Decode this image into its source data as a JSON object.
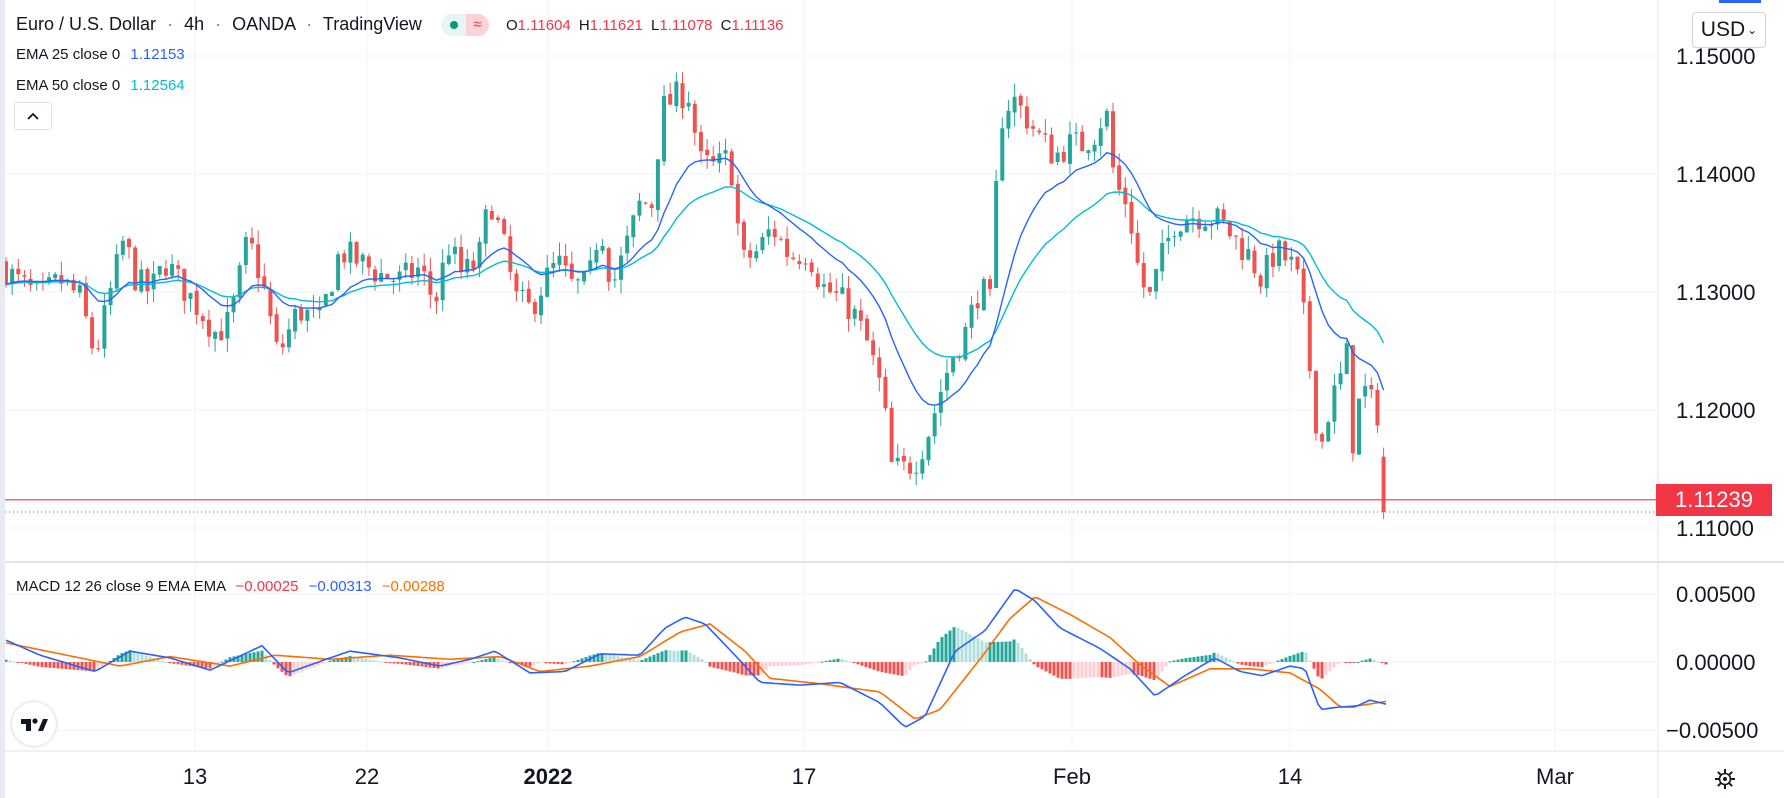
{
  "header": {
    "symbol": "Euro / U.S. Dollar",
    "interval": "4h",
    "broker": "OANDA",
    "platform": "TradingView",
    "separator": "·",
    "ohlc": {
      "o_label": "O",
      "o": "1.11604",
      "h_label": "H",
      "h": "1.11621",
      "l_label": "L",
      "l": "1.11078",
      "c_label": "C",
      "c": "1.11136"
    }
  },
  "legend": {
    "ema25_label": "EMA 25 close 0",
    "ema25_value": "1.12153",
    "ema50_label": "EMA 50 close 0",
    "ema50_value": "1.12564",
    "macd_label": "MACD 12 26 close 9 EMA EMA",
    "macd_hist": "−0.00025",
    "macd_line": "−0.00313",
    "macd_signal": "−0.00288"
  },
  "currency_button": "USD",
  "last_price": "1.11239",
  "colors": {
    "up": "#26a69a",
    "down": "#ef5350",
    "ema25": "#2962ff",
    "ema50": "#00bcd4",
    "macd": "#2962ff",
    "signal": "#ff6d00",
    "price_line": "#f23645"
  },
  "icons": [
    "chevron-up-icon",
    "tradingview-logo-icon",
    "settings-gear-icon",
    "status-dot-icon",
    "wave-icon"
  ],
  "chart_data": [
    {
      "type": "candlestick",
      "title": "Euro / U.S. Dollar · 4h · OANDA",
      "x_ticks": [
        "13",
        "22",
        "2022",
        "17",
        "Feb",
        "14",
        "Mar"
      ],
      "y_ticks": [
        "1.15000",
        "1.14000",
        "1.13000",
        "1.12000",
        "1.11000"
      ],
      "ylim": [
        1.1075,
        1.1515
      ],
      "last_price": 1.11239,
      "close_path": [
        [
          0,
          1.1325
        ],
        [
          16,
          1.131
        ],
        [
          40,
          1.1295
        ],
        [
          60,
          1.131
        ],
        [
          80,
          1.1295
        ],
        [
          95,
          1.1245
        ],
        [
          112,
          1.1305
        ],
        [
          124,
          1.1345
        ],
        [
          136,
          1.131
        ],
        [
          150,
          1.13
        ],
        [
          166,
          1.1325
        ],
        [
          182,
          1.1305
        ],
        [
          200,
          1.1285
        ],
        [
          216,
          1.1265
        ],
        [
          230,
          1.1275
        ],
        [
          248,
          1.1345
        ],
        [
          262,
          1.131
        ],
        [
          278,
          1.1245
        ],
        [
          298,
          1.1285
        ],
        [
          320,
          1.1275
        ],
        [
          340,
          1.1335
        ],
        [
          360,
          1.1325
        ],
        [
          380,
          1.1315
        ],
        [
          400,
          1.131
        ],
        [
          420,
          1.132
        ],
        [
          435,
          1.129
        ],
        [
          448,
          1.134
        ],
        [
          462,
          1.1315
        ],
        [
          478,
          1.1325
        ],
        [
          490,
          1.138
        ],
        [
          505,
          1.1335
        ],
        [
          515,
          1.1295
        ],
        [
          530,
          1.1285
        ],
        [
          545,
          1.131
        ],
        [
          558,
          1.1325
        ],
        [
          572,
          1.1305
        ],
        [
          588,
          1.1305
        ],
        [
          600,
          1.136
        ],
        [
          612,
          1.1305
        ],
        [
          625,
          1.1335
        ],
        [
          640,
          1.1375
        ],
        [
          652,
          1.1375
        ],
        [
          662,
          1.1455
        ],
        [
          675,
          1.1465
        ],
        [
          688,
          1.147
        ],
        [
          700,
          1.141
        ],
        [
          715,
          1.1405
        ],
        [
          730,
          1.1415
        ],
        [
          742,
          1.1325
        ],
        [
          758,
          1.1335
        ],
        [
          772,
          1.1355
        ],
        [
          790,
          1.133
        ],
        [
          808,
          1.1335
        ],
        [
          822,
          1.1305
        ],
        [
          838,
          1.1295
        ],
        [
          852,
          1.1285
        ],
        [
          868,
          1.1255
        ],
        [
          882,
          1.1215
        ],
        [
          892,
          1.115
        ],
        [
          905,
          1.115
        ],
        [
          918,
          1.116
        ],
        [
          930,
          1.1185
        ],
        [
          940,
          1.1215
        ],
        [
          952,
          1.1245
        ],
        [
          965,
          1.1265
        ],
        [
          980,
          1.1305
        ],
        [
          990,
          1.129
        ],
        [
          1000,
          1.1445
        ],
        [
          1012,
          1.1465
        ],
        [
          1025,
          1.145
        ],
        [
          1040,
          1.143
        ],
        [
          1055,
          1.1415
        ],
        [
          1068,
          1.1425
        ],
        [
          1082,
          1.1425
        ],
        [
          1095,
          1.1435
        ],
        [
          1106,
          1.1455
        ],
        [
          1115,
          1.139
        ],
        [
          1128,
          1.1375
        ],
        [
          1140,
          1.131
        ],
        [
          1150,
          1.1295
        ],
        [
          1162,
          1.133
        ],
        [
          1175,
          1.136
        ],
        [
          1190,
          1.1365
        ],
        [
          1205,
          1.1365
        ],
        [
          1220,
          1.136
        ],
        [
          1235,
          1.1345
        ],
        [
          1250,
          1.133
        ],
        [
          1262,
          1.131
        ],
        [
          1275,
          1.1335
        ],
        [
          1290,
          1.1325
        ],
        [
          1300,
          1.1305
        ],
        [
          1312,
          1.122
        ],
        [
          1320,
          1.1165
        ],
        [
          1330,
          1.1205
        ],
        [
          1340,
          1.1225
        ],
        [
          1348,
          1.125
        ],
        [
          1352,
          1.117
        ],
        [
          1362,
          1.122
        ],
        [
          1372,
          1.1205
        ],
        [
          1380,
          1.1195
        ],
        [
          1386,
          1.1114
        ]
      ],
      "series": [
        {
          "name": "EMA 25 close 0",
          "last": 1.12153
        },
        {
          "name": "EMA 50 close 0",
          "last": 1.12564
        }
      ]
    },
    {
      "type": "macd",
      "title": "MACD 12 26 close 9 EMA EMA",
      "y_ticks": [
        "0.00500",
        "0.00000",
        "−0.00500"
      ],
      "ylim": [
        -0.0062,
        0.0068
      ],
      "macd_path": [
        [
          0,
          0.0018
        ],
        [
          40,
          0.0005
        ],
        [
          95,
          -0.0007
        ],
        [
          130,
          0.0008
        ],
        [
          170,
          0.0003
        ],
        [
          210,
          -0.0006
        ],
        [
          262,
          0.0012
        ],
        [
          288,
          -0.0008
        ],
        [
          330,
          0.0003
        ],
        [
          350,
          0.0008
        ],
        [
          400,
          0.0003
        ],
        [
          440,
          -0.0003
        ],
        [
          470,
          0.0002
        ],
        [
          495,
          0.0008
        ],
        [
          530,
          -0.0008
        ],
        [
          565,
          -0.0007
        ],
        [
          600,
          0.0006
        ],
        [
          640,
          0.0005
        ],
        [
          665,
          0.0025
        ],
        [
          685,
          0.0033
        ],
        [
          705,
          0.0028
        ],
        [
          735,
          0.0005
        ],
        [
          760,
          -0.0015
        ],
        [
          800,
          -0.0017
        ],
        [
          840,
          -0.0015
        ],
        [
          880,
          -0.003
        ],
        [
          905,
          -0.0048
        ],
        [
          925,
          -0.004
        ],
        [
          955,
          0.0008
        ],
        [
          985,
          0.0023
        ],
        [
          1015,
          0.0054
        ],
        [
          1035,
          0.0045
        ],
        [
          1060,
          0.0025
        ],
        [
          1100,
          0.001
        ],
        [
          1130,
          -0.0005
        ],
        [
          1155,
          -0.0025
        ],
        [
          1185,
          -0.001
        ],
        [
          1215,
          0.0003
        ],
        [
          1240,
          -0.0007
        ],
        [
          1262,
          -0.001
        ],
        [
          1290,
          -0.0003
        ],
        [
          1305,
          -0.0005
        ],
        [
          1320,
          -0.0035
        ],
        [
          1340,
          -0.0033
        ],
        [
          1355,
          -0.0033
        ],
        [
          1370,
          -0.0028
        ],
        [
          1386,
          -0.0031
        ]
      ],
      "signal_path": [
        [
          0,
          0.0015
        ],
        [
          60,
          0.0006
        ],
        [
          120,
          -0.0003
        ],
        [
          170,
          0.0004
        ],
        [
          230,
          -0.0003
        ],
        [
          275,
          0.0005
        ],
        [
          330,
          0.0002
        ],
        [
          390,
          0.0005
        ],
        [
          450,
          0.0002
        ],
        [
          500,
          0.0004
        ],
        [
          540,
          -0.0007
        ],
        [
          590,
          -0.0003
        ],
        [
          640,
          0.0004
        ],
        [
          680,
          0.0022
        ],
        [
          710,
          0.0028
        ],
        [
          745,
          0.0008
        ],
        [
          770,
          -0.0012
        ],
        [
          820,
          -0.0016
        ],
        [
          880,
          -0.0022
        ],
        [
          915,
          -0.0042
        ],
        [
          940,
          -0.0035
        ],
        [
          980,
          0.0002
        ],
        [
          1010,
          0.0032
        ],
        [
          1035,
          0.0048
        ],
        [
          1070,
          0.0035
        ],
        [
          1110,
          0.0018
        ],
        [
          1140,
          -0.0002
        ],
        [
          1170,
          -0.0018
        ],
        [
          1210,
          -0.0005
        ],
        [
          1250,
          -0.0005
        ],
        [
          1290,
          -0.0008
        ],
        [
          1320,
          -0.002
        ],
        [
          1340,
          -0.0033
        ],
        [
          1360,
          -0.0032
        ],
        [
          1386,
          -0.0029
        ]
      ],
      "series": [
        {
          "name": "MACD",
          "last": -0.00313
        },
        {
          "name": "Signal",
          "last": -0.00288
        },
        {
          "name": "Histogram",
          "last": -0.00025
        }
      ]
    }
  ]
}
